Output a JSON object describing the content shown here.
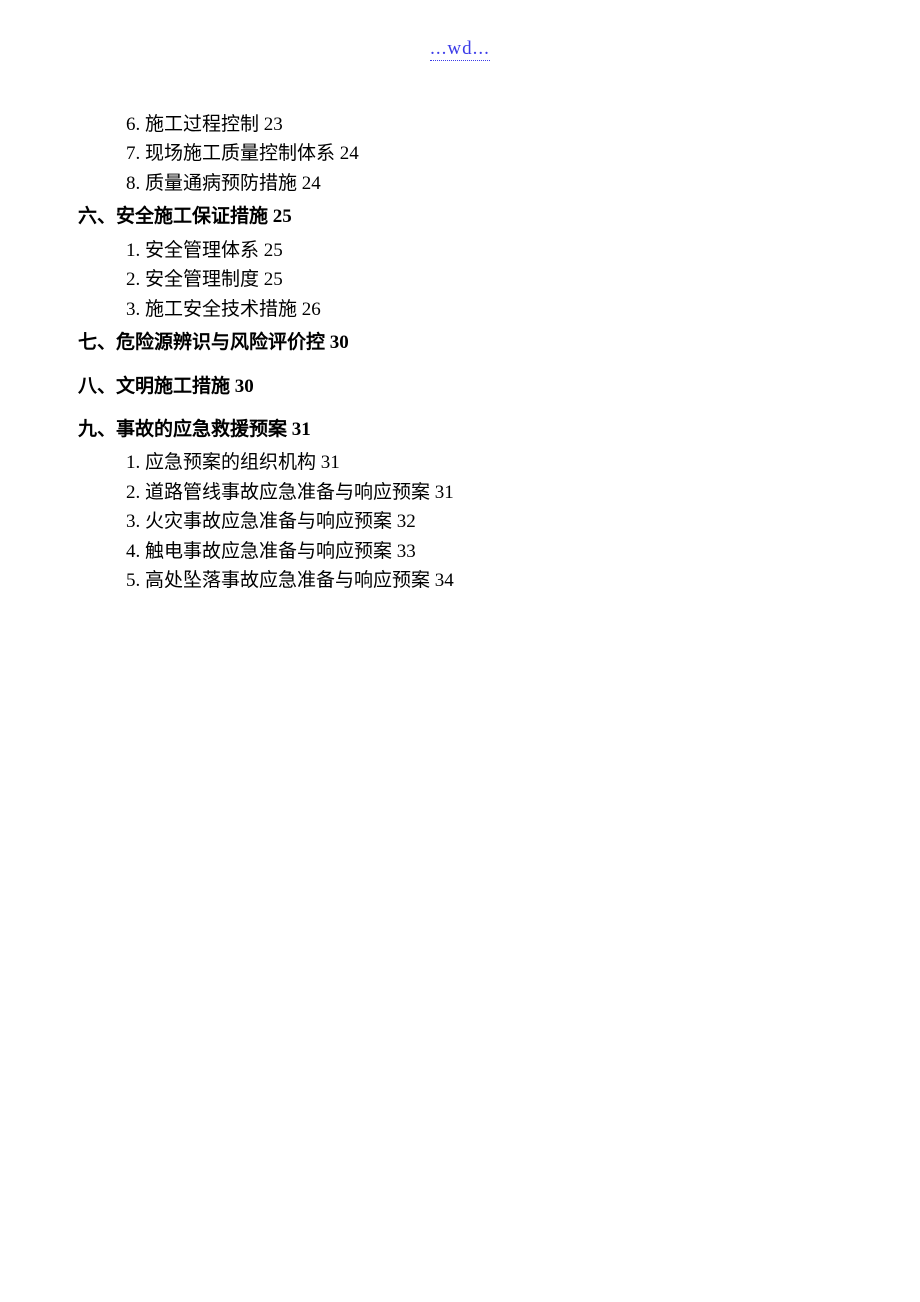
{
  "header": {
    "link_text": "...wd..."
  },
  "toc": {
    "orphan_items": [
      "6. 施工过程控制 23",
      "7. 现场施工质量控制体系 24",
      "8. 质量通病预防措施 24"
    ],
    "sections": [
      {
        "heading": "六、安全施工保证措施 25",
        "items": [
          "1. 安全管理体系 25",
          "2. 安全管理制度 25",
          "3. 施工安全技术措施 26"
        ]
      },
      {
        "heading": "七、危险源辨识与风险评价控 30",
        "items": []
      },
      {
        "heading": "八、文明施工措施 30",
        "items": []
      },
      {
        "heading": "九、事故的应急救援预案 31",
        "items": [
          "1. 应急预案的组织机构 31",
          "2. 道路管线事故应急准备与响应预案 31",
          "3. 火灾事故应急准备与响应预案 32",
          "4. 触电事故应急准备与响应预案 33",
          "5. 高处坠落事故应急准备与响应预案 34"
        ]
      }
    ]
  }
}
